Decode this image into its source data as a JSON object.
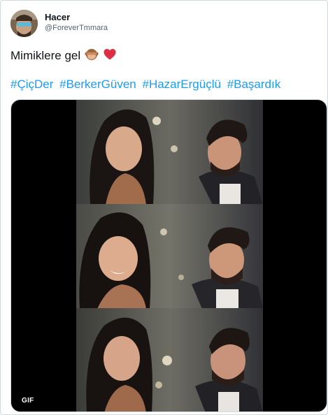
{
  "tweet": {
    "author_name": "Hacer",
    "author_handle": "@ForeverTmmara",
    "text": "Mimiklere gel",
    "emojis": [
      "see-no-evil-monkey-emoji",
      "red-heart-emoji"
    ],
    "hashtags": [
      "#ÇiçDer",
      "#BerkerGüven",
      "#HazarErgüçlü",
      "#Başardık"
    ]
  },
  "media": {
    "type_badge": "GIF",
    "frames": 3
  },
  "colors": {
    "link": "#1d9bf0",
    "text": "#0f1419",
    "secondary": "#536471",
    "border": "#cfd9de"
  }
}
